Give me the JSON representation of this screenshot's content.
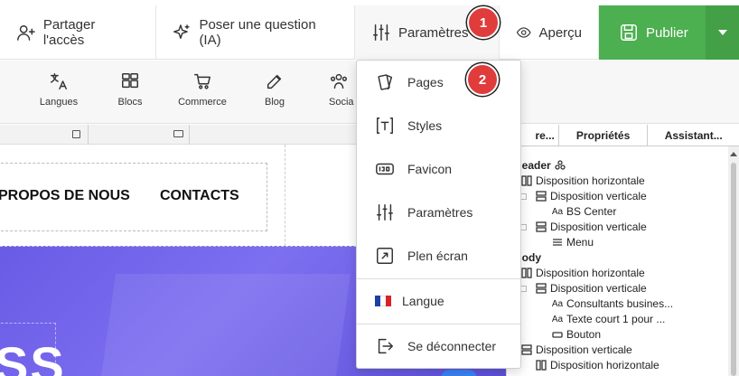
{
  "toolbar": {
    "share_label": "Partager l'accès",
    "ask_label": "Poser une question (IA)",
    "params_label": "Paramètres",
    "preview_label": "Aperçu",
    "publish_label": "Publier"
  },
  "subtoolbar": {
    "items": [
      {
        "label": "Langues",
        "icon": "translate-icon"
      },
      {
        "label": "Blocs",
        "icon": "blocks-icon"
      },
      {
        "label": "Commerce",
        "icon": "cart-icon"
      },
      {
        "label": "Blog",
        "icon": "pencil-icon"
      },
      {
        "label": "Socia",
        "icon": "people-icon"
      }
    ]
  },
  "canvas": {
    "nav_links": [
      "PROPOS DE NOUS",
      "CONTACTS"
    ],
    "hero_text": "SS"
  },
  "dropdown": {
    "items": [
      {
        "label": "Pages",
        "icon": "pages-icon"
      },
      {
        "label": "Styles",
        "icon": "styles-icon"
      },
      {
        "label": "Favicon",
        "icon": "favicon-icon"
      },
      {
        "label": "Paramètres",
        "icon": "sliders-icon"
      },
      {
        "label": "Plen écran",
        "icon": "fullscreen-icon"
      },
      {
        "label": "Langue",
        "icon": "french-flag-icon"
      },
      {
        "label": "Se déconnecter",
        "icon": "logout-icon"
      }
    ]
  },
  "panel": {
    "tabs": [
      "re...",
      "Propriétés",
      "Assistant..."
    ],
    "tree": [
      {
        "label": "Header",
        "icon": "component-icon",
        "bold": true
      },
      {
        "label": "Disposition horizontale",
        "icon": "columns-icon"
      },
      {
        "label": "Disposition verticale",
        "icon": "rows-icon"
      },
      {
        "label": "BS Center",
        "icon": "text-icon"
      },
      {
        "label": "Disposition verticale",
        "icon": "rows-icon"
      },
      {
        "label": "Menu",
        "icon": "menu-icon"
      },
      {
        "label": "Body",
        "icon": "",
        "bold": true
      },
      {
        "label": "Disposition horizontale",
        "icon": "columns-icon"
      },
      {
        "label": "Disposition verticale",
        "icon": "rows-icon"
      },
      {
        "label": "Consultants busines...",
        "icon": "text-icon"
      },
      {
        "label": "Texte court 1 pour ...",
        "icon": "text-icon"
      },
      {
        "label": "Bouton",
        "icon": "button-icon"
      },
      {
        "label": "Disposition verticale",
        "icon": "rows-icon"
      },
      {
        "label": "Disposition horizontale",
        "icon": "columns-icon"
      }
    ]
  },
  "badges": [
    "1",
    "2"
  ],
  "colors": {
    "publish": "#4caf50",
    "badge": "#e03c3c",
    "hero": "#6a5be6"
  }
}
